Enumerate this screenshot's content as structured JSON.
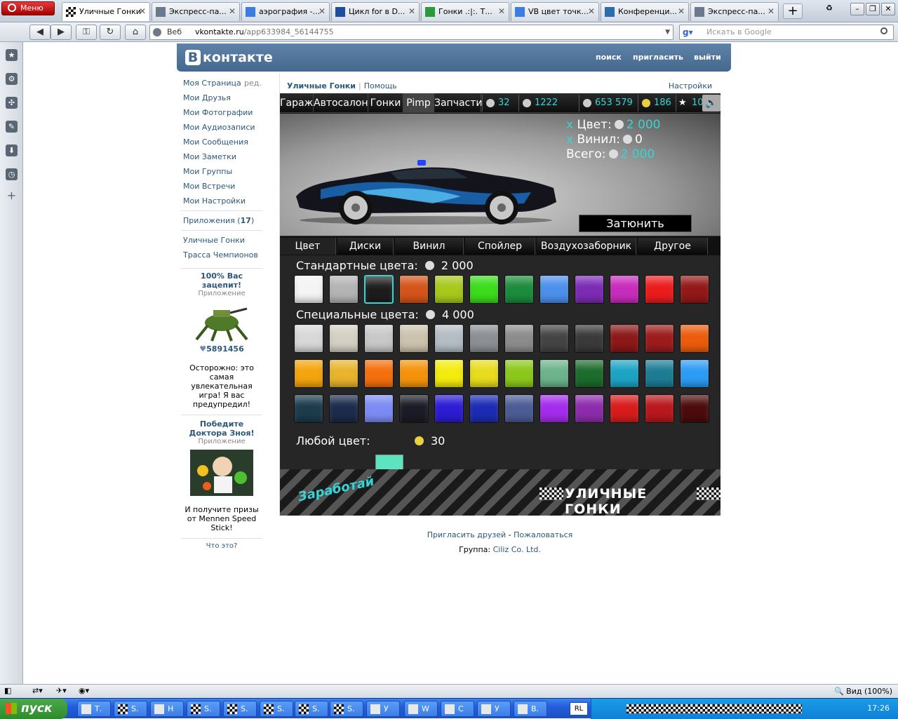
{
  "browser": {
    "menu_label": "Меню",
    "tabs": [
      {
        "label": "Уличные Гонки",
        "icon": "checkered-flag-icon"
      },
      {
        "label": "Экспресс-па...",
        "icon": "grid-icon"
      },
      {
        "label": "аэрография -...",
        "icon": "google-icon"
      },
      {
        "label": "Цикл for в D...",
        "icon": "site-k-icon"
      },
      {
        "label": "Гонки .:|:. Т...",
        "icon": "site-h-icon"
      },
      {
        "label": "VB цвет точк...",
        "icon": "google-icon"
      },
      {
        "label": "Конференци...",
        "icon": "site-vb-icon"
      },
      {
        "label": "Экспресс-па...",
        "icon": "grid-icon"
      }
    ],
    "address_prefix": "Веб",
    "url_host": "vkontakte.ru",
    "url_path": "/app633984_56144755",
    "search_placeholder": "Искать в Google",
    "zoom": "Вид (100%)"
  },
  "vk": {
    "logo_text": "контакте",
    "logo_letter": "В",
    "nav": [
      "поиск",
      "пригласить",
      "выйти"
    ],
    "menu": [
      {
        "label": "Моя Страница",
        "extra": "ред."
      },
      {
        "label": "Мои Друзья"
      },
      {
        "label": "Мои Фотографии"
      },
      {
        "label": "Мои Аудиозаписи"
      },
      {
        "label": "Мои Сообщения"
      },
      {
        "label": "Мои Заметки"
      },
      {
        "label": "Мои Группы"
      },
      {
        "label": "Мои Встречи"
      },
      {
        "label": "Мои Настройки"
      }
    ],
    "apps_label": "Приложения",
    "apps_count": "17",
    "my_apps": [
      "Уличные Гонки",
      "Трасса Чемпионов"
    ],
    "ad1": {
      "title": "100% Вас зацепит!",
      "sub": "Приложение",
      "likes": "5891456",
      "text": "Осторожно: это самая увлекательная игра! Я вас предупредил!"
    },
    "ad2": {
      "title": "Победите Доктора Зноя!",
      "sub": "Приложение",
      "text": "И получите призы от Mennen Speed Stick!",
      "what": "Что это?"
    },
    "app_name": "Уличные Гонки",
    "help": "Помощь",
    "settings": "Настройки",
    "footer_invite": "Пригласить друзей",
    "footer_sep": "-",
    "footer_report": "Пожаловаться",
    "footer_group_label": "Группа:",
    "footer_group": "Ciliz Co. Ltd."
  },
  "game": {
    "nav": [
      "Гараж",
      "Автосалон",
      "Гонки",
      "Pimp",
      "Запчасти"
    ],
    "stats": [
      "32",
      "1222",
      "653 579",
      "186",
      "10"
    ],
    "price": {
      "color_label": "Цвет:",
      "color_value": "2 000",
      "vinyl_label": "Винил:",
      "vinyl_value": "0",
      "total_label": "Всего:",
      "total_value": "2 000",
      "x": "x"
    },
    "tune_button": "Затюнить",
    "subtabs": [
      "Цвет",
      "Диски",
      "Винил",
      "Спойлер",
      "Воздухозаборник",
      "Другое"
    ],
    "standard_label": "Стандартные цвета:",
    "standard_price": "2 000",
    "special_label": "Специальные цвета:",
    "special_price": "4 000",
    "any_label": "Любой цвет:",
    "any_price": "30",
    "any_color": "#5ce3c0",
    "selected_color": "#37d4d4",
    "banner_earn": "Заработай",
    "banner_title": "УЛИЧНЫЕ ГОНКИ",
    "standard_colors": [
      "#f4f4f4",
      "#b4b4b4",
      "#1d1d1d",
      "#d4541a",
      "#a8c81c",
      "#3cdc1c",
      "#1c8c3c",
      "#4c90ec",
      "#7c2cb4",
      "#c82cbc",
      "#ec1c1c",
      "#941818"
    ],
    "special_colors": [
      [
        "#d8d8d8",
        "#d4d0c4",
        "#c8c8c8",
        "#cbc3ac",
        "#b4bcc4",
        "#8c9094",
        "#8c8c8c",
        "#444444",
        "#3a3a3a",
        "#8c1818",
        "#9c1c1c",
        "#ec5c0c"
      ],
      [
        "#f4a40c",
        "#e8b42c",
        "#f4700c",
        "#f4940c",
        "#f4ec0c",
        "#e8dc1c",
        "#8cc81c",
        "#6cb48c",
        "#1c6c2c",
        "#1ca4c4",
        "#1c7c94",
        "#2c9cf4"
      ],
      [
        "#1c3c4c",
        "#1c2c4c",
        "#7c8cf4",
        "#1c1c28",
        "#2c1cd4",
        "#1c2cb4",
        "#4c5c94",
        "#a42cec",
        "#8c2cac",
        "#d81c1c",
        "#b8181c",
        "#4c0c0c"
      ]
    ]
  },
  "taskbar": {
    "start": "пуск",
    "buttons": [
      "Т.",
      "S.",
      "Н",
      "S.",
      "S.",
      "S.",
      "S.",
      "S.",
      "У",
      "W",
      "С",
      "У",
      "В."
    ],
    "lang": "RL",
    "clock": "17:26"
  }
}
